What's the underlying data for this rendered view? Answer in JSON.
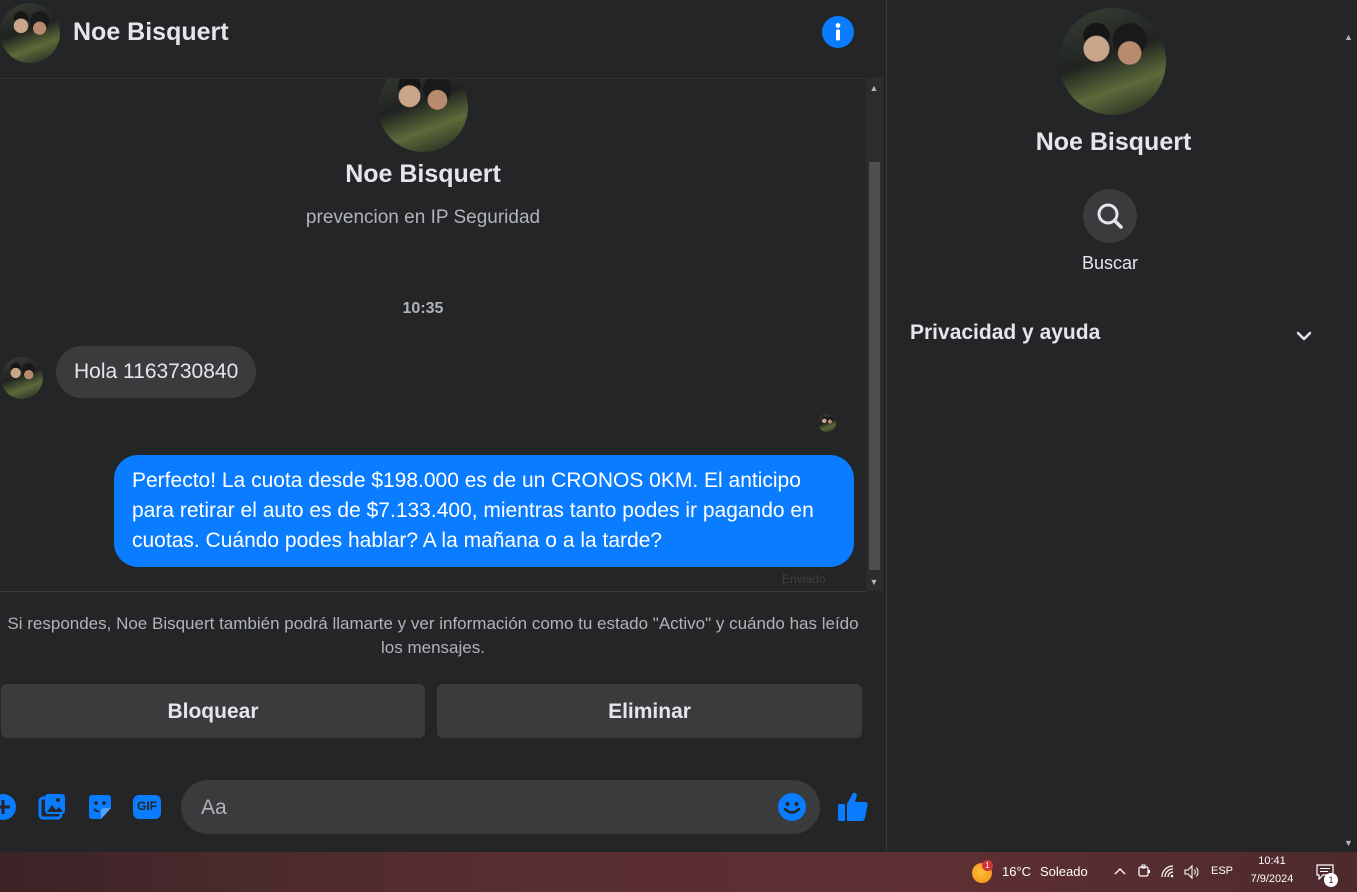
{
  "header": {
    "contact_name": "Noe Bisquert"
  },
  "conversation": {
    "contact_name": "Noe Bisquert",
    "contact_subtitle": "prevencion en IP Seguridad",
    "timestamp": "10:35",
    "messages": [
      {
        "direction": "incoming",
        "text": "Hola 1163730840"
      },
      {
        "direction": "outgoing",
        "text": "Perfecto! La cuota desde $198.000 es de un CRONOS 0KM. El anticipo para retirar el auto es de $7.133.400, mientras tanto podes ir pagando en cuotas. Cuándo podes hablar? A la mañana o a la tarde?"
      }
    ],
    "status_hint": "Enviado"
  },
  "notice": {
    "text": "Si respondes, Noe Bisquert también podrá llamarte y ver información como tu estado \"Activo\" y cuándo has leído los mensajes."
  },
  "actions": {
    "block_label": "Bloquear",
    "delete_label": "Eliminar"
  },
  "composer": {
    "placeholder": "Aa",
    "icons": [
      "plus-icon",
      "image-icon",
      "sticker-icon",
      "gif-icon",
      "emoji-icon",
      "thumbs-up-icon"
    ],
    "gif_text": "GIF"
  },
  "side_panel": {
    "contact_name": "Noe Bisquert",
    "search_label": "Buscar",
    "privacy_label": "Privacidad y ayuda"
  },
  "taskbar": {
    "weather_temp": "16°C",
    "weather_text": "Soleado",
    "weather_badge": "1",
    "language": "ESP",
    "time": "10:41",
    "date": "7/9/2024",
    "notification_count": "1"
  },
  "colors": {
    "background": "#242526",
    "accent": "#0a7cff",
    "surface": "#3a3b3c",
    "text_primary": "#e4e6eb",
    "text_secondary": "#b0b3b8"
  }
}
